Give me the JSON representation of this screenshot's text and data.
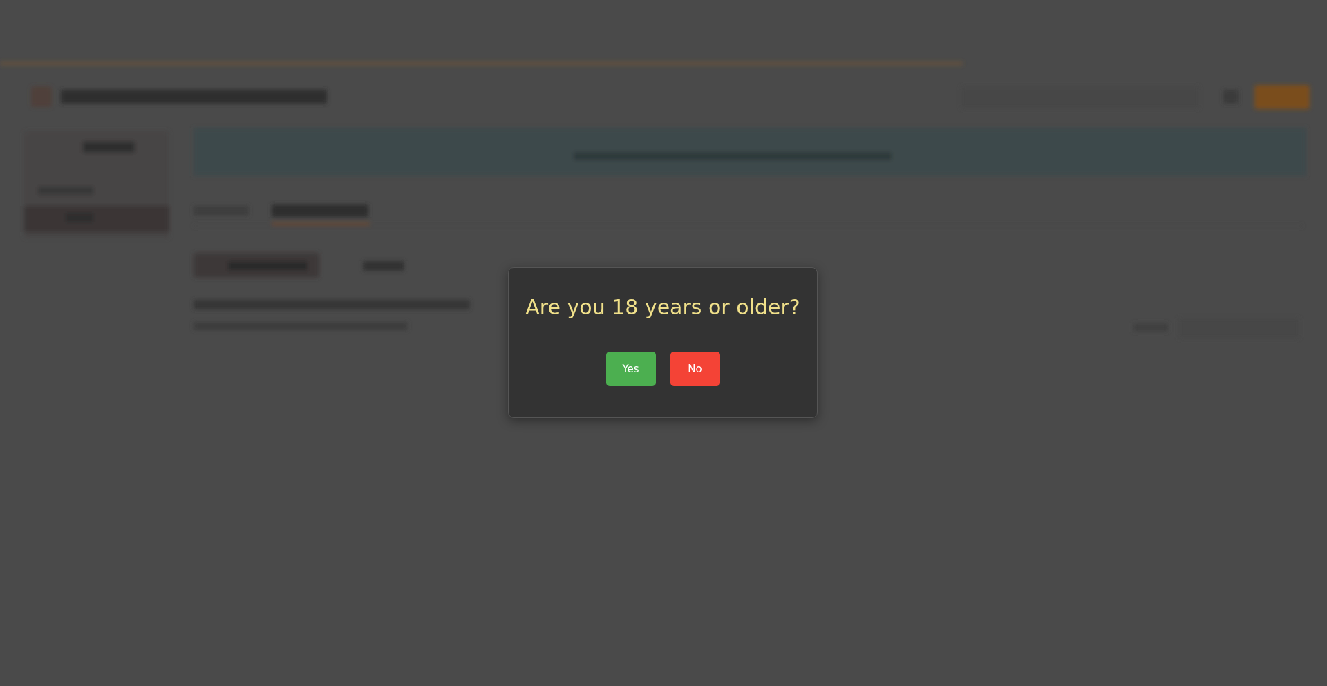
{
  "dialog": {
    "title": "Are you 18 years or older?",
    "buttons": [
      {
        "label": "Yes",
        "kind": "confirm"
      },
      {
        "label": "No",
        "kind": "cancel"
      }
    ]
  }
}
